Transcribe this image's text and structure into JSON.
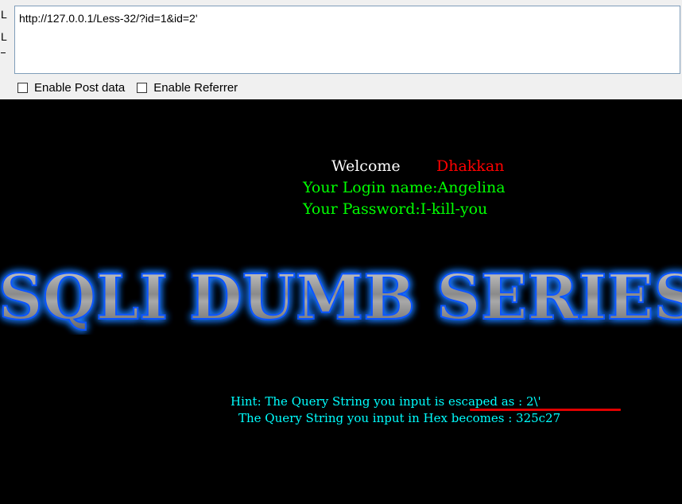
{
  "toolbar": {
    "side_label_1": "L",
    "side_label_2": "L",
    "url_value": "http://127.0.0.1/Less-32/?id=1&id=2'",
    "enable_post_label": "Enable Post data",
    "enable_referrer_label": "Enable Referrer"
  },
  "page": {
    "welcome_word": "Welcome",
    "welcome_name": "Dhakkan",
    "login_line": "Your Login name:Angelina",
    "password_line": "Your Password:I-kill-you",
    "banner_text": "SQLI DUMB SERIES",
    "hint_line": "Hint: The Query String you input is escaped as : 2\\'",
    "hex_line": "The Query String you input in Hex becomes : 325c27"
  },
  "colors": {
    "welcome": "#ffffff",
    "name": "#ff0000",
    "credentials": "#00ff00",
    "hint": "#00ffff",
    "banner_glow": "#1e7bff"
  }
}
